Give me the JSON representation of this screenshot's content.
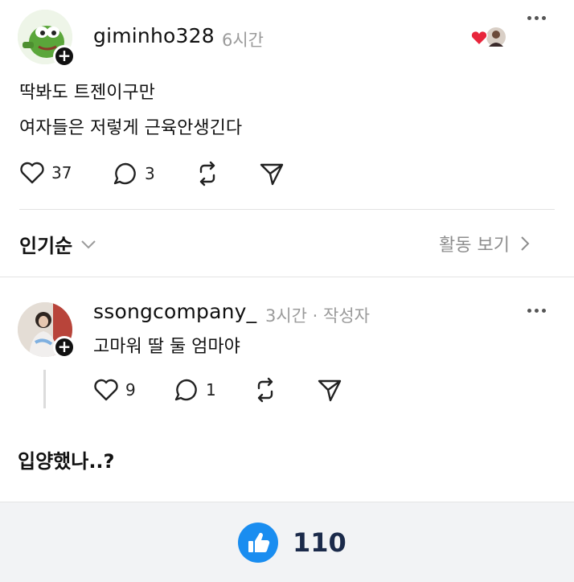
{
  "post": {
    "username": "giminho328",
    "time": "6시간",
    "lines": [
      "딱봐도 트젠이구만",
      "여자들은 저렇게 근육안생긴다"
    ],
    "likes": "37",
    "comments": "3"
  },
  "sort": {
    "label": "인기순",
    "activity": "활동 보기"
  },
  "comment": {
    "username": "ssongcompany_",
    "meta": "3시간 · 작성자",
    "text": "고마워 딸 둘 엄마야",
    "likes": "9",
    "comments": "1"
  },
  "caption": "입양했나..?",
  "footer": {
    "like_count": "110"
  },
  "colors": {
    "heart": "#e8253b",
    "like_button": "#1a8df0",
    "like_count": "#1b2a4a"
  }
}
